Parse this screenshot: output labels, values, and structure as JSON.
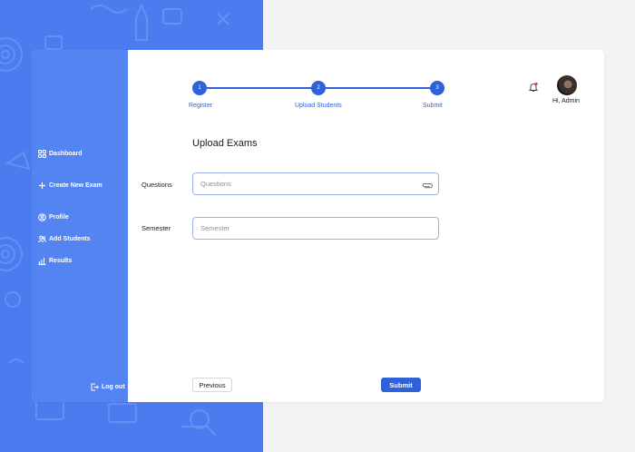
{
  "sidebar": {
    "items": [
      {
        "label": "Dashboard",
        "icon": "grid-icon"
      },
      {
        "label": "Create New Exam",
        "icon": "plus-icon"
      },
      {
        "label": "Profile",
        "icon": "user-circle-icon"
      },
      {
        "label": "Add Students",
        "icon": "users-icon"
      },
      {
        "label": "Results",
        "icon": "bar-chart-icon"
      }
    ],
    "logout_label": "Log out"
  },
  "stepper": {
    "steps": [
      {
        "number": "1",
        "label": "Register"
      },
      {
        "number": "2",
        "label": "Upload Students"
      },
      {
        "number": "3",
        "label": "Submit"
      }
    ]
  },
  "header": {
    "greeting": "Hi, Admin"
  },
  "form": {
    "title": "Upload Exams",
    "questions_label": "Questions",
    "questions_placeholder": "Questions",
    "semester_label": "Semester",
    "semester_placeholder": "Semester"
  },
  "actions": {
    "previous_label": "Previous",
    "submit_label": "Submit"
  },
  "colors": {
    "brand": "#2f62d8",
    "sidebar": "#5484f2",
    "background_pattern": "#4a7cf0"
  }
}
